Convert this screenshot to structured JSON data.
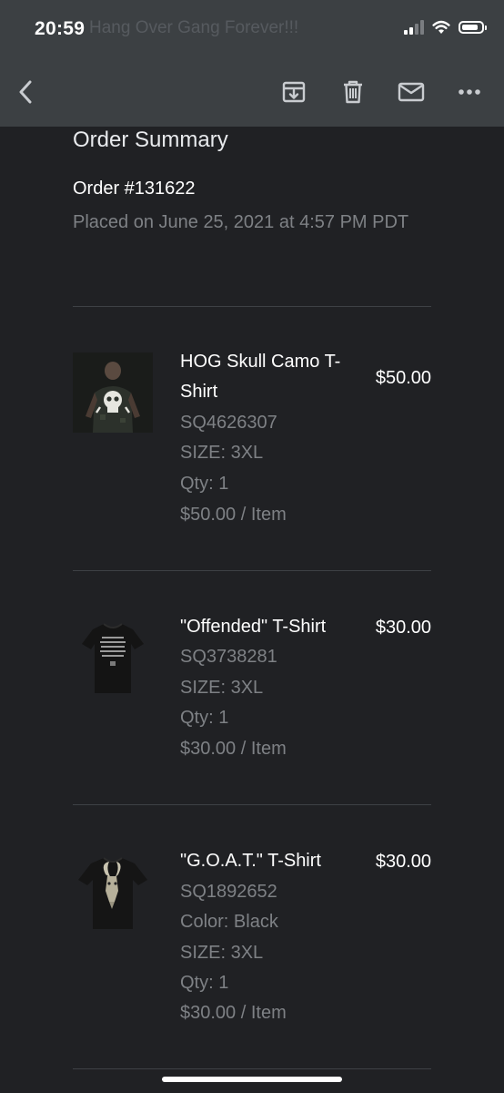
{
  "status_bar": {
    "time": "20:59",
    "behind_text": "Hang Over Gang Forever!!!",
    "battery_level": 0.85
  },
  "toolbar": {
    "back_icon": "back-arrow-icon",
    "archive_icon": "archive-icon",
    "delete_icon": "trash-icon",
    "mark_unread_icon": "mail-icon",
    "more_icon": "more-icon"
  },
  "summary": {
    "title": "Order Summary",
    "order_number": "Order #131622",
    "placed": "Placed on June 25, 2021 at 4:57 PM PDT"
  },
  "items": [
    {
      "name": "HOG Skull Camo T-Shirt",
      "price": "$50.00",
      "sku": "SQ4626307",
      "size": "SIZE: 3XL",
      "qty": "Qty: 1",
      "unit_price": "$50.00 / Item"
    },
    {
      "name": "\"Offended\" T-Shirt",
      "price": "$30.00",
      "sku": "SQ3738281",
      "size": "SIZE: 3XL",
      "qty": "Qty: 1",
      "unit_price": "$30.00 / Item"
    },
    {
      "name": "\"G.O.A.T.\" T-Shirt",
      "price": "$30.00",
      "sku": "SQ1892652",
      "color": "Color: Black",
      "size": "SIZE: 3XL",
      "qty": "Qty: 1",
      "unit_price": "$30.00 / Item"
    }
  ],
  "colors": {
    "background": "#202124",
    "toolbar": "#3c4043",
    "primary_text": "#ffffff",
    "secondary_text": "#7e8185"
  }
}
